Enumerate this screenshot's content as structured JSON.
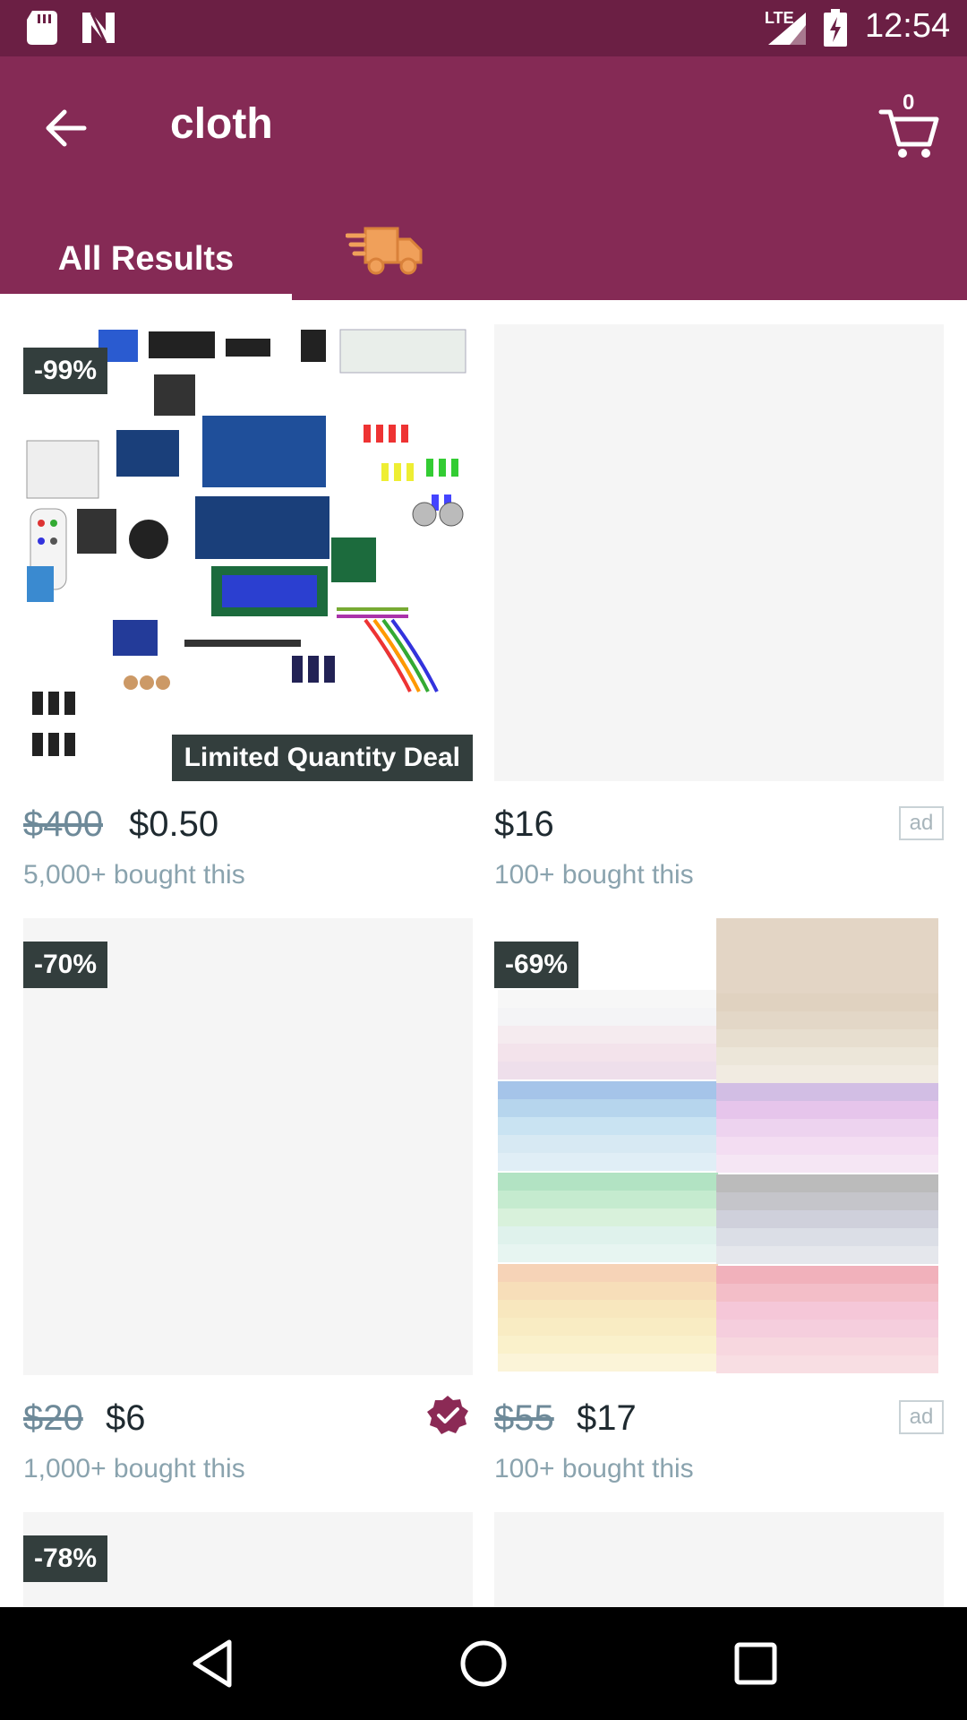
{
  "status_bar": {
    "time": "12:54",
    "network": "LTE",
    "icons": [
      "sd-card-icon",
      "n-logo-icon",
      "signal-icon",
      "battery-charging-icon"
    ]
  },
  "app_bar": {
    "search_query": "cloth",
    "cart_count": "0",
    "back_icon": "arrow-left-icon",
    "cart_icon": "cart-icon"
  },
  "tabs": [
    {
      "label": "All Results",
      "active": true
    },
    {
      "label": "",
      "icon": "fast-shipping-truck-icon",
      "active": false
    }
  ],
  "colors": {
    "status_bar": "#6b1f44",
    "app_bar": "#852a55",
    "badge": "#333e3d",
    "old_price": "#6e8a99",
    "bought_text": "#8aa3ae",
    "verified": "#8b2a55",
    "truck": "#f0a05a"
  },
  "products": [
    {
      "discount": "-99%",
      "deal_label": "Limited Quantity Deal",
      "old_price": "$400",
      "price": "$0.50",
      "bought": "5,000+ bought this",
      "ad": "",
      "image": "electronics-starter-kit"
    },
    {
      "discount": "",
      "old_price": "",
      "price": "$16",
      "bought": "100+ bought this",
      "ad": "ad",
      "image": "blank"
    },
    {
      "discount": "-70%",
      "old_price": "$20",
      "price": "$6",
      "bought": "1,000+ bought this",
      "ad": "",
      "verified": true,
      "image": "blank"
    },
    {
      "discount": "-69%",
      "old_price": "$55",
      "price": "$17",
      "bought": "100+ bought this",
      "ad": "ad",
      "image": "folded-colored-cloth-stacks"
    },
    {
      "discount": "-78%",
      "old_price": "",
      "price": "",
      "bought": "",
      "ad": "",
      "image": "blank"
    },
    {
      "discount": "",
      "old_price": "",
      "price": "",
      "bought": "",
      "ad": "",
      "image": "blank"
    }
  ],
  "nav_bar": {
    "back": "triangle-back-icon",
    "home": "circle-home-icon",
    "recents": "square-recents-icon"
  }
}
